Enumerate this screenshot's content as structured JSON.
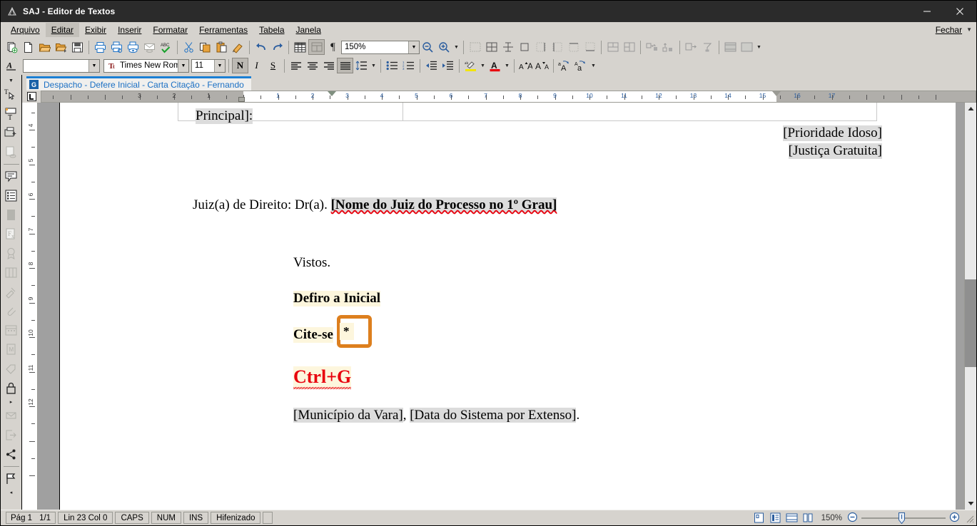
{
  "window": {
    "title": "SAJ - Editor de Textos",
    "app_icon": "saj-logo-icon",
    "minimize_label": "—",
    "close_label": "✕"
  },
  "menu": {
    "items": [
      {
        "label": "Arquivo",
        "name": "menu-arquivo"
      },
      {
        "label": "Editar",
        "name": "menu-editar"
      },
      {
        "label": "Exibir",
        "name": "menu-exibir"
      },
      {
        "label": "Inserir",
        "name": "menu-inserir"
      },
      {
        "label": "Formatar",
        "name": "menu-formatar"
      },
      {
        "label": "Ferramentas",
        "name": "menu-ferramentas"
      },
      {
        "label": "Tabela",
        "name": "menu-tabela"
      },
      {
        "label": "Janela",
        "name": "menu-janela"
      }
    ],
    "right_label": "Fechar"
  },
  "toolbar": {
    "zoom_value": "150%",
    "style_value": "",
    "font_value": "Times New Romar",
    "font_size_value": "11",
    "bold_label": "N",
    "italic_label": "I",
    "underline_label": "S",
    "pilcrow_label": "¶",
    "font_icon_label": "Tt"
  },
  "document_tab": {
    "glyph": "G",
    "label": "Despacho - Defere Inicial - Carta Citação - Fernando"
  },
  "ruler": {
    "tab_selector_label": "L",
    "horizontal_numbers": [
      "3",
      "2",
      "1",
      "1",
      "2",
      "3",
      "4",
      "5",
      "6",
      "7",
      "8",
      "9",
      "10",
      "11",
      "12",
      "13",
      "14",
      "15",
      "16",
      "17"
    ],
    "vertical_numbers": [
      "4",
      "5",
      "6",
      "7",
      "8",
      "9",
      "10",
      "11",
      "12"
    ]
  },
  "document": {
    "lines": [
      {
        "id": "principal",
        "text": "Principal]:",
        "style": "field"
      },
      {
        "id": "prioridade",
        "text": "[Prioridade Idoso]",
        "style": "field"
      },
      {
        "id": "justica",
        "text": "[Justiça Gratuita]",
        "style": "field"
      },
      {
        "id": "juiz_prefix",
        "text": "Juiz(a) de Direito: Dr(a). ",
        "style": "plain"
      },
      {
        "id": "juiz_field",
        "text": "[Nome do Juiz do Processo no 1º Grau]",
        "style": "field-bold"
      },
      {
        "id": "vistos",
        "text": "Vistos.",
        "style": "plain"
      },
      {
        "id": "defiro",
        "text": "Defiro a Inicial",
        "style": "highlight-bold"
      },
      {
        "id": "citese",
        "text": "Cite-se",
        "style": "highlight-bold"
      },
      {
        "id": "ctrlg",
        "text": "Ctrl+G",
        "style": "red-bold-highlight-spell"
      },
      {
        "id": "municipio",
        "text": "[Município da Vara]",
        "style": "field"
      },
      {
        "id": "comma",
        "text": ", ",
        "style": "plain"
      },
      {
        "id": "data",
        "text": "[Data do Sistema por Extenso]",
        "style": "field"
      },
      {
        "id": "period",
        "text": ".",
        "style": "plain"
      }
    ],
    "annotation": {
      "symbol": "*",
      "border_color": "#dd7f1e"
    }
  },
  "statusbar": {
    "page_label": "Pág 1",
    "page_count": "1/1",
    "line_col": "Lin 23  Col 0",
    "caps": "CAPS",
    "num": "NUM",
    "ins": "INS",
    "hyphen": "Hifenizado",
    "zoom_percent": "150%",
    "zoom_out_label": "−",
    "zoom_in_label": "+"
  },
  "colors": {
    "accent_blue": "#1a7fd4",
    "annotation_orange": "#dd7f1e",
    "field_gray": "#dcdcdc",
    "highlight_yellow": "#fdf6dd",
    "spell_red": "#e8000d",
    "chrome_gray": "#d6d3ce"
  }
}
